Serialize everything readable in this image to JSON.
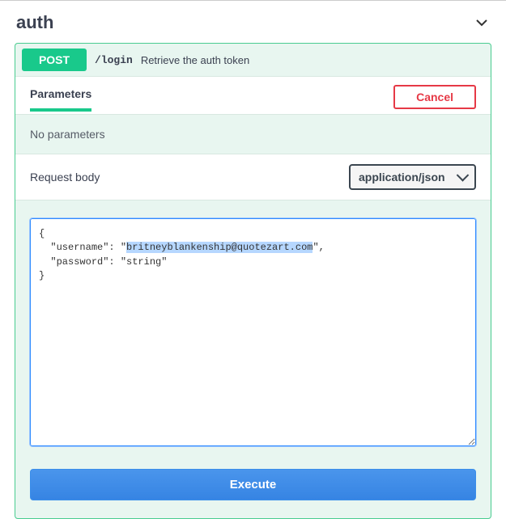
{
  "tag": {
    "name": "auth"
  },
  "operation": {
    "method": "POST",
    "path": "/login",
    "summary": "Retrieve the auth token"
  },
  "tabs": {
    "parameters": "Parameters"
  },
  "buttons": {
    "cancel": "Cancel",
    "execute": "Execute"
  },
  "parameters": {
    "empty_message": "No parameters"
  },
  "request_body": {
    "label": "Request body",
    "content_type": "application/json",
    "field_user_key": "username",
    "field_user_val": "britneyblankenship@quotezart.com",
    "field_pass_key": "password",
    "field_pass_val": "string"
  }
}
